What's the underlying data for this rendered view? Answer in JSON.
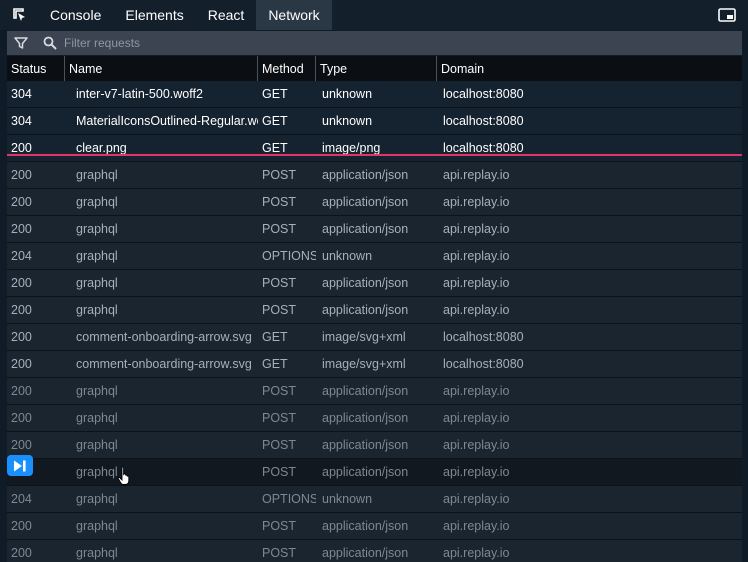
{
  "tabbar": {
    "inspect_icon": "element-picker-icon",
    "tabs": [
      {
        "label": "Console",
        "active": false
      },
      {
        "label": "Elements",
        "active": false
      },
      {
        "label": "React",
        "active": false
      },
      {
        "label": "Network",
        "active": true
      }
    ],
    "layout_icon": "dock-layout-icon"
  },
  "filter": {
    "funnel_icon": "funnel-icon",
    "search_icon": "search-icon",
    "placeholder": "Filter requests",
    "value": ""
  },
  "table": {
    "columns": [
      "Status",
      "Name",
      "Method",
      "Type",
      "Domain"
    ],
    "rows": [
      {
        "status": "304",
        "name": "inter-v7-latin-500.woff2",
        "method": "GET",
        "type": "unknown",
        "domain": "localhost:8080",
        "state": "past"
      },
      {
        "status": "304",
        "name": "MaterialIconsOutlined-Regular.woff",
        "method": "GET",
        "type": "unknown",
        "domain": "localhost:8080",
        "state": "past"
      },
      {
        "status": "200",
        "name": "clear.png",
        "method": "GET",
        "type": "image/png",
        "domain": "localhost:8080",
        "state": "past"
      },
      {
        "status": "200",
        "name": "graphql",
        "method": "POST",
        "type": "application/json",
        "domain": "api.replay.io",
        "state": "future-mid"
      },
      {
        "status": "200",
        "name": "graphql",
        "method": "POST",
        "type": "application/json",
        "domain": "api.replay.io",
        "state": "future-mid"
      },
      {
        "status": "200",
        "name": "graphql",
        "method": "POST",
        "type": "application/json",
        "domain": "api.replay.io",
        "state": "future-mid"
      },
      {
        "status": "204",
        "name": "graphql",
        "method": "OPTIONS",
        "type": "unknown",
        "domain": "api.replay.io",
        "state": "future-mid"
      },
      {
        "status": "200",
        "name": "graphql",
        "method": "POST",
        "type": "application/json",
        "domain": "api.replay.io",
        "state": "future-mid"
      },
      {
        "status": "200",
        "name": "graphql",
        "method": "POST",
        "type": "application/json",
        "domain": "api.replay.io",
        "state": "future-mid"
      },
      {
        "status": "200",
        "name": "comment-onboarding-arrow.svg",
        "method": "GET",
        "type": "image/svg+xml",
        "domain": "localhost:8080",
        "state": "future-mid"
      },
      {
        "status": "200",
        "name": "comment-onboarding-arrow.svg",
        "method": "GET",
        "type": "image/svg+xml",
        "domain": "localhost:8080",
        "state": "future-mid"
      },
      {
        "status": "200",
        "name": "graphql",
        "method": "POST",
        "type": "application/json",
        "domain": "api.replay.io",
        "state": "future-dim"
      },
      {
        "status": "200",
        "name": "graphql",
        "method": "POST",
        "type": "application/json",
        "domain": "api.replay.io",
        "state": "future-dim"
      },
      {
        "status": "200",
        "name": "graphql",
        "method": "POST",
        "type": "application/json",
        "domain": "api.replay.io",
        "state": "future-dim"
      },
      {
        "status": "",
        "name": "graphql",
        "method": "POST",
        "type": "application/json",
        "domain": "api.replay.io",
        "state": "hover"
      },
      {
        "status": "204",
        "name": "graphql",
        "method": "OPTIONS",
        "type": "unknown",
        "domain": "api.replay.io",
        "state": "future-dim"
      },
      {
        "status": "200",
        "name": "graphql",
        "method": "POST",
        "type": "application/json",
        "domain": "api.replay.io",
        "state": "future-dim"
      },
      {
        "status": "200",
        "name": "graphql",
        "method": "POST",
        "type": "application/json",
        "domain": "api.replay.io",
        "state": "future-dim"
      }
    ],
    "seek_icon": "seek-to-request-icon"
  },
  "colors": {
    "playhead_line": "#e0346a",
    "seek_button": "#1a90ff",
    "active_tab_bg": "#2a3744"
  }
}
